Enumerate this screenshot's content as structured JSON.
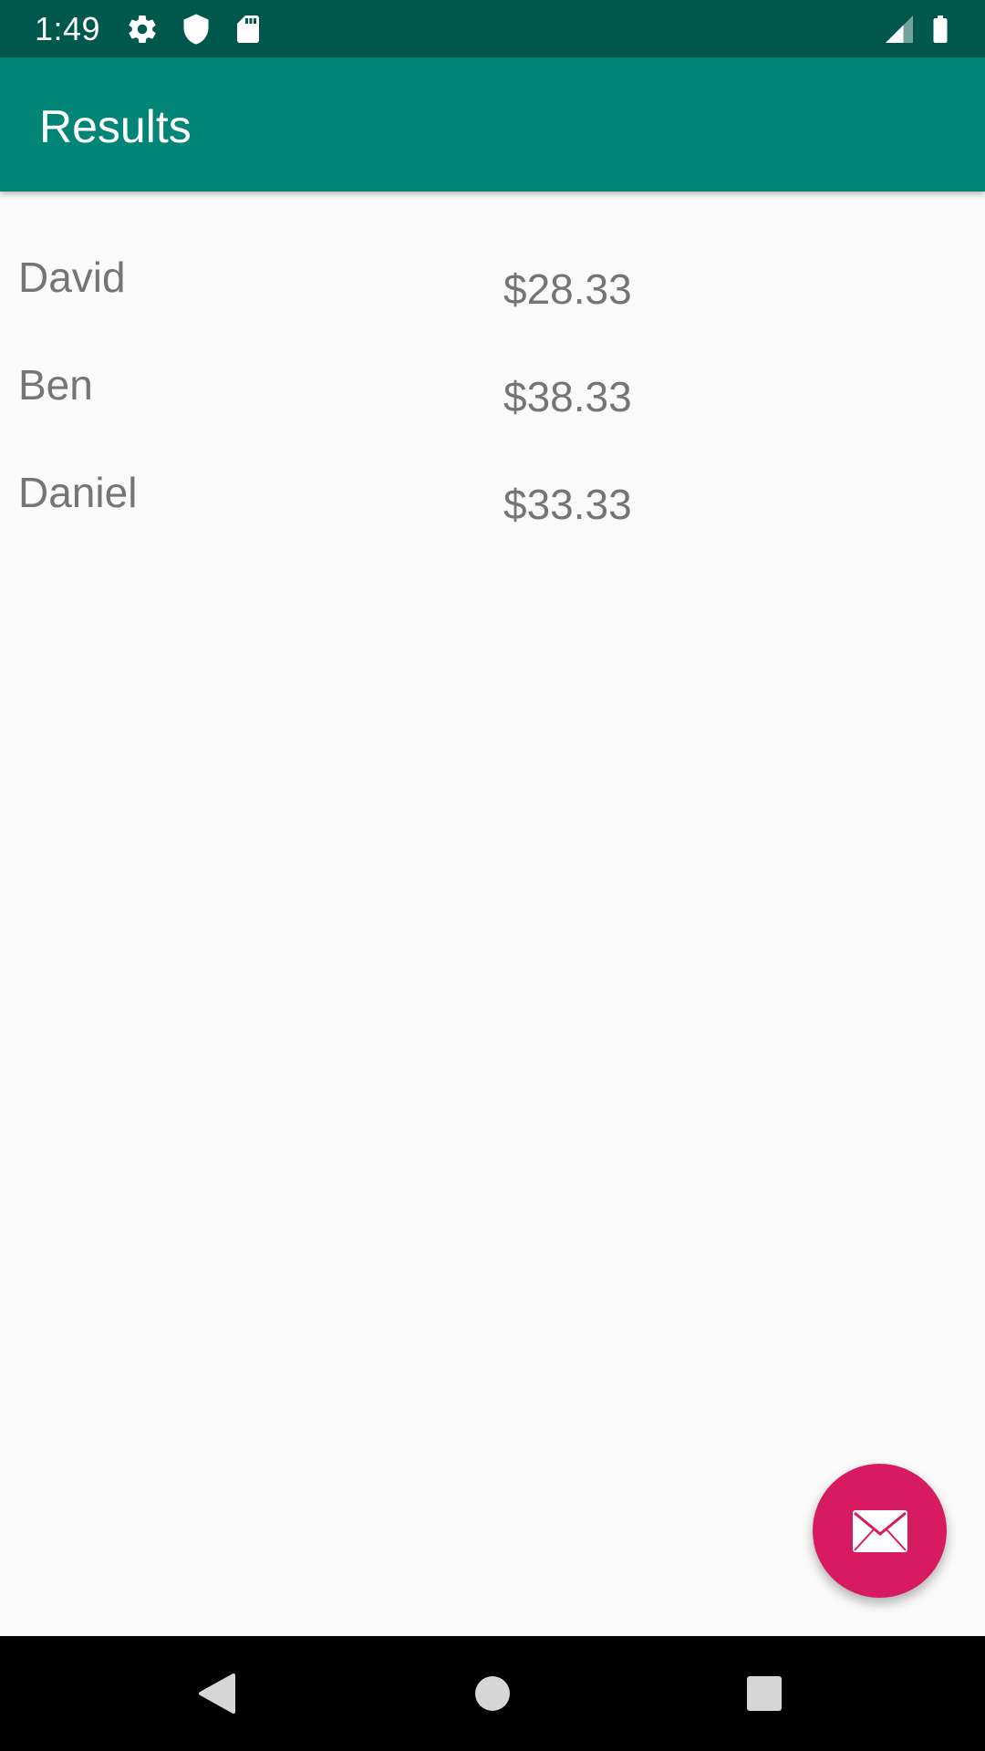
{
  "status_bar": {
    "time": "1:49",
    "icons": [
      "gear-icon",
      "shield-icon",
      "sd-card-icon",
      "signal-icon",
      "battery-icon"
    ],
    "color": "#00574b"
  },
  "app_bar": {
    "title": "Results",
    "color": "#008577"
  },
  "list": {
    "rows": [
      {
        "name": "David",
        "amount": "$28.33"
      },
      {
        "name": "Ben",
        "amount": "$38.33"
      },
      {
        "name": "Daniel",
        "amount": "$33.33"
      }
    ]
  },
  "fab": {
    "icon": "mail-icon",
    "color": "#d81b60"
  },
  "nav_bar": {
    "buttons": [
      "back-icon",
      "home-icon",
      "recents-icon"
    ]
  }
}
